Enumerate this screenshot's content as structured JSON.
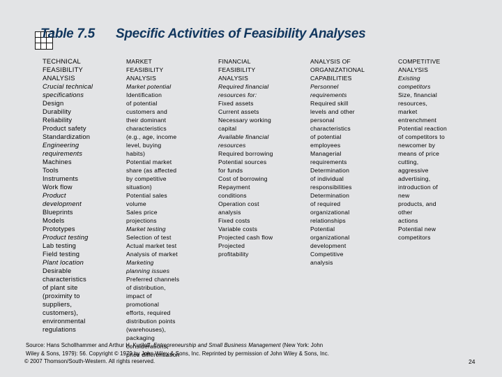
{
  "header": {
    "table_number": "Table 7.5",
    "title": "Specific Activities of Feasibility Analyses",
    "icon": "table-grid-icon",
    "title_color": "#12375e"
  },
  "columns": [
    {
      "heading": [
        "TECHNICAL",
        "FEASIBILITY",
        "ANALYSIS"
      ],
      "lines": [
        {
          "t": "Crucial technical",
          "i": true
        },
        {
          "t": "specifications",
          "i": true
        },
        {
          "t": "Design",
          "i": false
        },
        {
          "t": "Durability",
          "i": false
        },
        {
          "t": "Reliability",
          "i": false
        },
        {
          "t": "Product safety",
          "i": false
        },
        {
          "t": "Standardization",
          "i": false
        },
        {
          "t": "Engineering",
          "i": true
        },
        {
          "t": "requirements",
          "i": true
        },
        {
          "t": "Machines",
          "i": false
        },
        {
          "t": "Tools",
          "i": false
        },
        {
          "t": "Instruments",
          "i": false
        },
        {
          "t": "Work flow",
          "i": false
        },
        {
          "t": "Product",
          "i": true
        },
        {
          "t": "development",
          "i": true
        },
        {
          "t": "Blueprints",
          "i": false
        },
        {
          "t": "Models",
          "i": false
        },
        {
          "t": "Prototypes",
          "i": false
        },
        {
          "t": "Product testing",
          "i": true
        },
        {
          "t": "Lab testing",
          "i": false
        },
        {
          "t": "Field testing",
          "i": false
        },
        {
          "t": "Plant location",
          "i": true
        },
        {
          "t": "Desirable",
          "i": false
        },
        {
          "t": "characteristics",
          "i": false
        },
        {
          "t": "of plant site",
          "i": false
        },
        {
          "t": "(proximity to",
          "i": false
        },
        {
          "t": "suppliers,",
          "i": false
        },
        {
          "t": "customers),",
          "i": false
        },
        {
          "t": "environmental",
          "i": false
        },
        {
          "t": "regulations",
          "i": false
        }
      ]
    },
    {
      "heading": [
        "MARKET",
        "FEASIBILITY",
        "ANALYSIS"
      ],
      "lines": [
        {
          "t": "Market potential",
          "i": true
        },
        {
          "t": "Identification",
          "i": false
        },
        {
          "t": "of potential",
          "i": false
        },
        {
          "t": "customers and",
          "i": false
        },
        {
          "t": "their dominant",
          "i": false
        },
        {
          "t": "characteristics",
          "i": false
        },
        {
          "t": "(e.g., age, income",
          "i": false
        },
        {
          "t": "level, buying",
          "i": false
        },
        {
          "t": "habits)",
          "i": false
        },
        {
          "t": "Potential market",
          "i": false
        },
        {
          "t": "share (as affected",
          "i": false
        },
        {
          "t": "by competitive",
          "i": false
        },
        {
          "t": "situation)",
          "i": false
        },
        {
          "t": "Potential sales",
          "i": false
        },
        {
          "t": "volume",
          "i": false
        },
        {
          "t": "Sales price",
          "i": false
        },
        {
          "t": "projections",
          "i": false
        },
        {
          "t": "Market testing",
          "i": true
        },
        {
          "t": "Selection of test",
          "i": false
        },
        {
          "t": "Actual market test",
          "i": false
        },
        {
          "t": "Analysis of market",
          "i": false
        },
        {
          "t": "Marketing",
          "i": true
        },
        {
          "t": "planning issues",
          "i": true
        },
        {
          "t": "Preferred channels",
          "i": false
        },
        {
          "t": "of distribution,",
          "i": false
        },
        {
          "t": "impact of",
          "i": false
        },
        {
          "t": "promotional",
          "i": false
        },
        {
          "t": "efforts, required",
          "i": false
        },
        {
          "t": "distribution points",
          "i": false
        },
        {
          "t": "(warehouses),",
          "i": false
        },
        {
          "t": "packaging",
          "i": false
        },
        {
          "t": "considerations,",
          "i": false
        },
        {
          "t": "price differentiation",
          "i": false
        }
      ]
    },
    {
      "heading": [
        "FINANCIAL",
        "FEASIBILITY",
        "ANALYSIS"
      ],
      "lines": [
        {
          "t": "Required financial",
          "i": true
        },
        {
          "t": "resources for:",
          "i": true
        },
        {
          "t": "Fixed assets",
          "i": false
        },
        {
          "t": "Current assets",
          "i": false
        },
        {
          "t": "Necessary working",
          "i": false
        },
        {
          "t": "capital",
          "i": false
        },
        {
          "t": "Available financial",
          "i": true
        },
        {
          "t": "resources",
          "i": true
        },
        {
          "t": "Required borrowing",
          "i": false
        },
        {
          "t": "Potential sources",
          "i": false
        },
        {
          "t": "for funds",
          "i": false
        },
        {
          "t": "Cost of borrowing",
          "i": false
        },
        {
          "t": "Repayment",
          "i": false
        },
        {
          "t": "conditions",
          "i": false
        },
        {
          "t": "Operation cost",
          "i": false
        },
        {
          "t": "analysis",
          "i": false
        },
        {
          "t": "Fixed costs",
          "i": false
        },
        {
          "t": "Variable costs",
          "i": false
        },
        {
          "t": "Projected cash flow",
          "i": false
        },
        {
          "t": "Projected",
          "i": false
        },
        {
          "t": "profitability",
          "i": false
        }
      ]
    },
    {
      "heading": [
        "ANALYSIS OF",
        "ORGANIZATIONAL",
        "CAPABILITIES"
      ],
      "lines": [
        {
          "t": "Personnel",
          "i": true
        },
        {
          "t": "requirements",
          "i": true
        },
        {
          "t": "Required skill",
          "i": false
        },
        {
          "t": "levels and other",
          "i": false
        },
        {
          "t": "personal",
          "i": false
        },
        {
          "t": "characteristics",
          "i": false
        },
        {
          "t": "of potential",
          "i": false
        },
        {
          "t": "employees",
          "i": false
        },
        {
          "t": "Managerial",
          "i": false
        },
        {
          "t": "requirements",
          "i": false
        },
        {
          "t": "Determination",
          "i": false
        },
        {
          "t": "of individual",
          "i": false
        },
        {
          "t": "responsibilities",
          "i": false
        },
        {
          "t": "Determination",
          "i": false
        },
        {
          "t": "of required",
          "i": false
        },
        {
          "t": "organizational",
          "i": false
        },
        {
          "t": "relationships",
          "i": false
        },
        {
          "t": "Potential",
          "i": false
        },
        {
          "t": "organizational",
          "i": false
        },
        {
          "t": "development",
          "i": false
        },
        {
          "t": "Competitive",
          "i": false
        },
        {
          "t": "analysis",
          "i": false
        }
      ]
    },
    {
      "heading": [
        "COMPETITIVE",
        "ANALYSIS"
      ],
      "lines": [
        {
          "t": "Existing",
          "i": true
        },
        {
          "t": "competitors",
          "i": true
        },
        {
          "t": "Size, financial",
          "i": false
        },
        {
          "t": "resources,",
          "i": false
        },
        {
          "t": "market",
          "i": false
        },
        {
          "t": "entrenchment",
          "i": false
        },
        {
          "t": "Potential reaction",
          "i": false
        },
        {
          "t": "of competitors to",
          "i": false
        },
        {
          "t": "newcomer by",
          "i": false
        },
        {
          "t": "means of price",
          "i": false
        },
        {
          "t": "cutting,",
          "i": false
        },
        {
          "t": "aggressive",
          "i": false
        },
        {
          "t": "advertising,",
          "i": false
        },
        {
          "t": "introduction of",
          "i": false
        },
        {
          "t": "new",
          "i": false
        },
        {
          "t": "products, and",
          "i": false
        },
        {
          "t": "other",
          "i": false
        },
        {
          "t": "actions",
          "i": false
        },
        {
          "t": "Potential new",
          "i": false
        },
        {
          "t": "competitors",
          "i": false
        }
      ]
    }
  ],
  "footer": {
    "source_prefix": "Source: Hans Schollhammer and Arthur H. Kuriloff, ",
    "source_book": "Entrepreneurship and Small Business Management",
    "source_suffix": " (New York: John",
    "source_line2": "Wiley & Sons, 1979): 56. Copyright © 1979 by John Wiley & Sons, Inc. Reprinted by permission of John Wiley & Sons, Inc.",
    "copyright": "© 2007 Thomson/South-Western. All rights reserved.",
    "page_number": "24"
  }
}
